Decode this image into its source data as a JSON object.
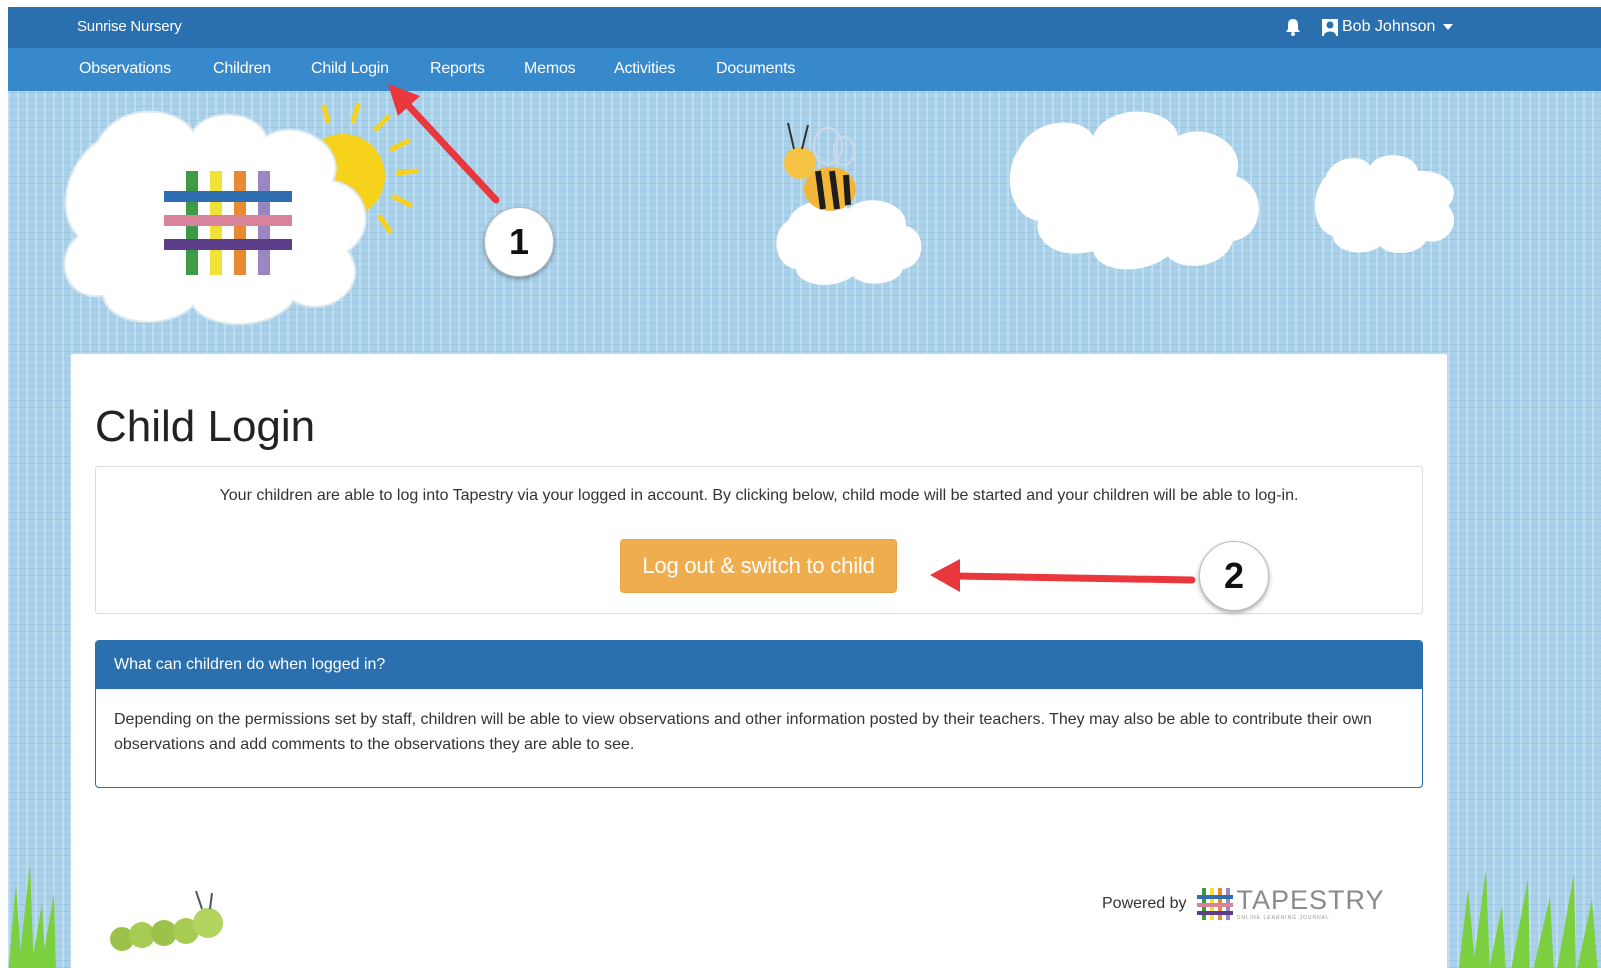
{
  "header": {
    "brand": "Sunrise Nursery",
    "user_name": "Bob Johnson",
    "icons": [
      "bell-icon",
      "user-icon",
      "caret-down-icon"
    ]
  },
  "nav": {
    "items": [
      {
        "label": "Observations"
      },
      {
        "label": "Children"
      },
      {
        "label": "Child Login"
      },
      {
        "label": "Reports"
      },
      {
        "label": "Memos"
      },
      {
        "label": "Activities"
      },
      {
        "label": "Documents"
      }
    ]
  },
  "main": {
    "title": "Child Login",
    "intro": "Your children are able to log into Tapestry via your logged in account. By clicking below, child mode will be started and your children will be able to log-in.",
    "switch_button": "Log out & switch to child",
    "panel": {
      "heading": "What can children do when logged in?",
      "body": "Depending on the permissions set by staff, children will be able to view observations and other information posted by their teachers. They may also be able to contribute their own observations and add comments to the observations they are able to see."
    }
  },
  "footer": {
    "powered_by": "Powered by",
    "logo_word": "TAPESTRY",
    "logo_tagline": "ONLINE LEARNING JOURNAL"
  },
  "annotations": {
    "step1": "1",
    "step2": "2",
    "arrow_color": "#e8383d"
  },
  "colors": {
    "topbar": "#2a6fae",
    "navbar": "#3789cc",
    "sky": "#a9d2ea",
    "button": "#f0ad4e",
    "panel_header": "#2a6fae"
  }
}
